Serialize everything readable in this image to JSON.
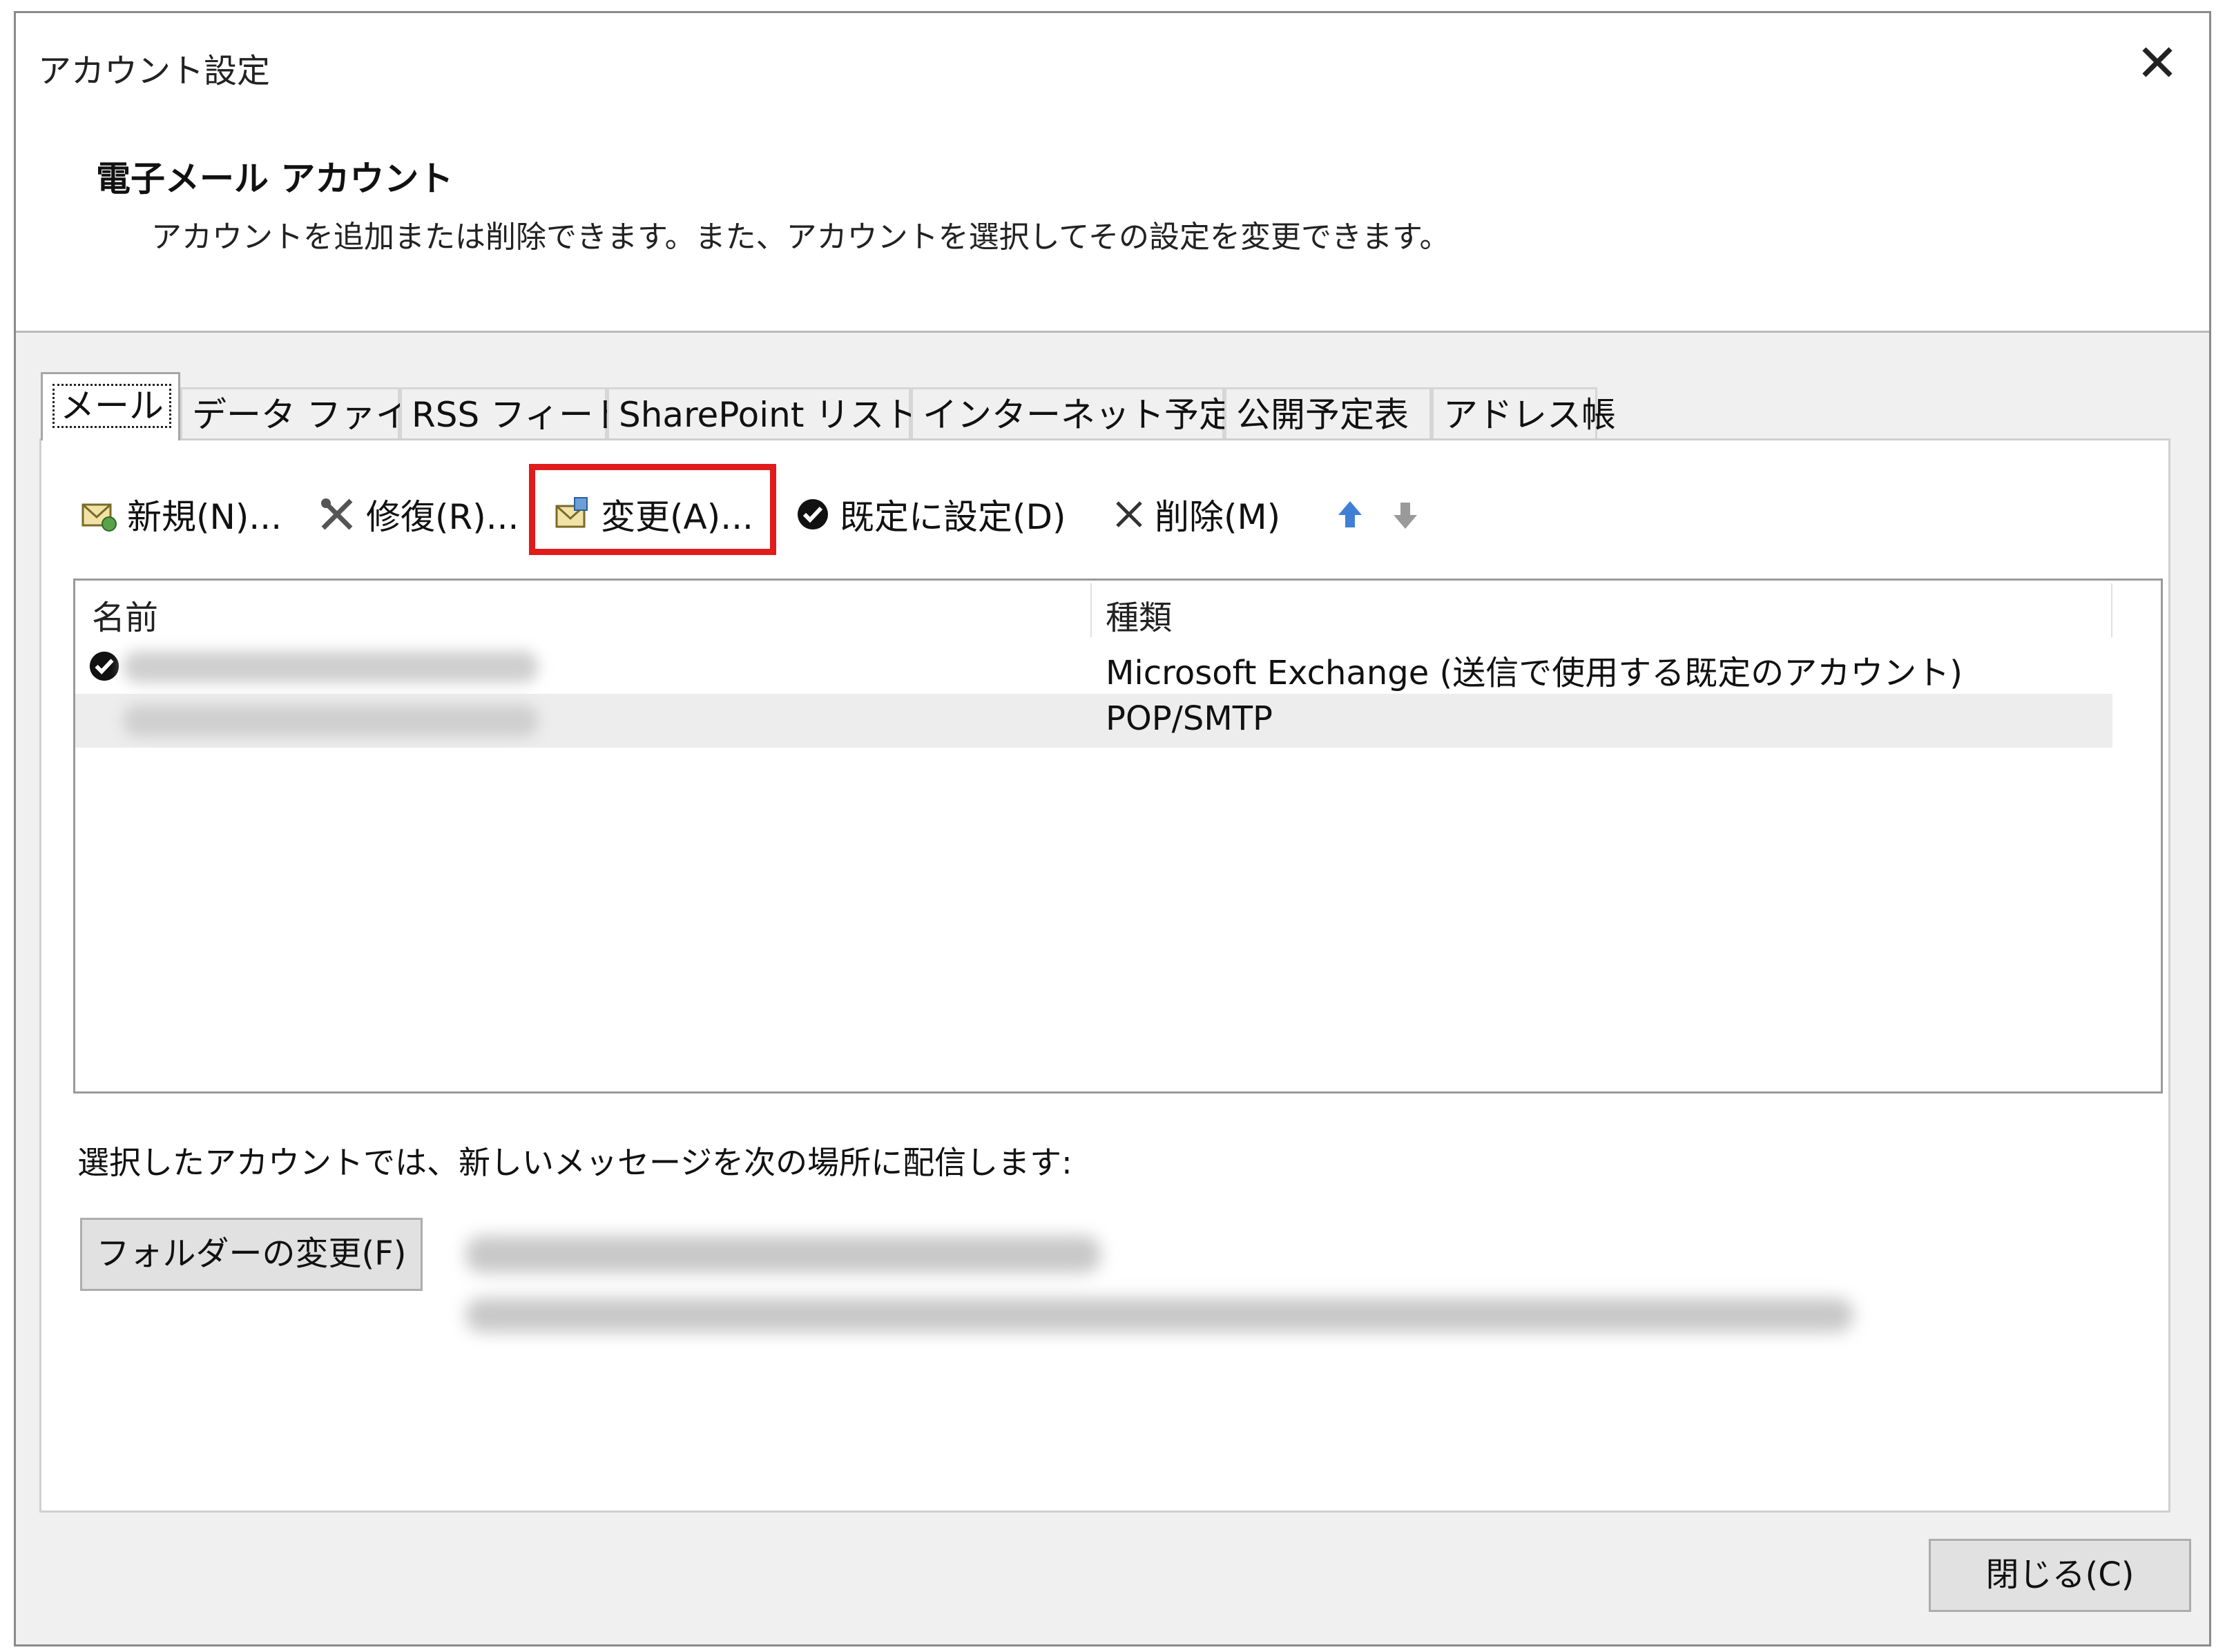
{
  "window": {
    "title": "アカウント設定",
    "close_glyph": "✕"
  },
  "header": {
    "title": "電子メール アカウント",
    "description": "アカウントを追加または削除できます。また、アカウントを選択してその設定を変更できます。"
  },
  "tabs": [
    {
      "label": "メール",
      "active": true
    },
    {
      "label": "データ ファイル"
    },
    {
      "label": "RSS フィード"
    },
    {
      "label": "SharePoint リスト"
    },
    {
      "label": "インターネット予定表"
    },
    {
      "label": "公開予定表"
    },
    {
      "label": "アドレス帳"
    }
  ],
  "toolbar": {
    "new_label": "新規(N)...",
    "repair_label": "修復(R)...",
    "change_label": "変更(A)...",
    "set_default_label": "既定に設定(D)",
    "delete_label": "削除(M)",
    "highlight_color": "#e11b1b",
    "icons": [
      "new-mail-account-icon",
      "repair-tools-icon",
      "change-account-icon",
      "checkmark-icon",
      "delete-x-icon",
      "move-up-arrow-icon",
      "move-down-arrow-icon"
    ]
  },
  "accounts_table": {
    "headers": {
      "name": "名前",
      "type": "種類"
    },
    "rows": [
      {
        "name": "",
        "type": "Microsoft Exchange (送信で使用する既定のアカウント)",
        "default": true
      },
      {
        "name": "",
        "type": "POP/SMTP",
        "default": false
      }
    ]
  },
  "delivery": {
    "label": "選択したアカウントでは、新しいメッセージを次の場所に配信します:",
    "change_folder_label": "フォルダーの変更(F)"
  },
  "footer": {
    "close_label": "閉じる(C)"
  }
}
